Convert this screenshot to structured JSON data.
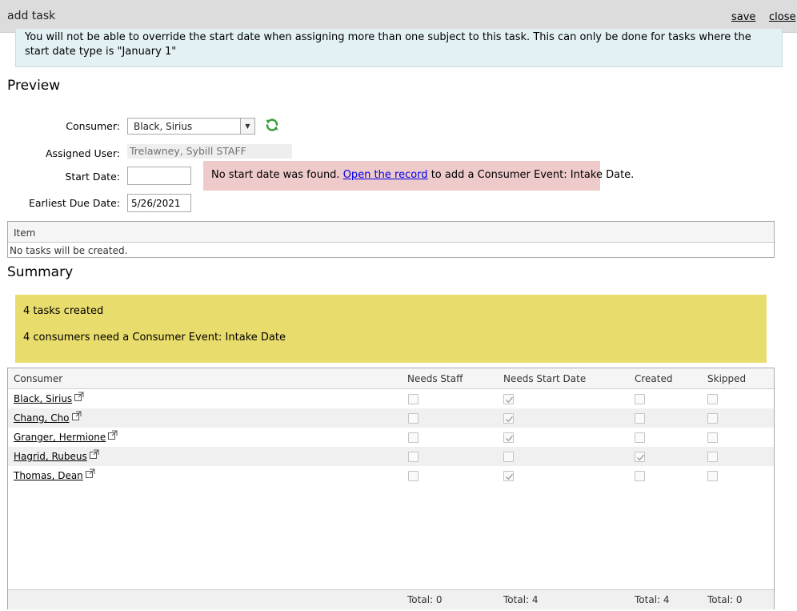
{
  "window": {
    "title": "add task",
    "save_label": "save",
    "close_label": "close"
  },
  "info_message": "You will not be able to override the start date when assigning more than one subject to this task. This can only be done for tasks where the start date type is \"January 1\"",
  "preview": {
    "title": "Preview",
    "consumer_label": "Consumer:",
    "consumer_value": "Black, Sirius",
    "assigned_user_label": "Assigned User:",
    "assigned_user_value": "Trelawney, Sybill STAFF",
    "start_date_label": "Start Date:",
    "start_date_value": "",
    "earliest_due_date_label": "Earliest Due Date:",
    "earliest_due_date_value": "5/26/2021",
    "error": {
      "prefix": "No start date was found. ",
      "link": "Open the record",
      "suffix": " to add a Consumer Event: Intake Date."
    },
    "item_table": {
      "header": "Item",
      "empty_text": "No tasks will be created."
    }
  },
  "summary": {
    "title": "Summary",
    "line1": "4 tasks created",
    "line2": "4 consumers need a Consumer Event: Intake Date"
  },
  "grid": {
    "headers": {
      "consumer": "Consumer",
      "needs_staff": "Needs Staff",
      "needs_start_date": "Needs Start Date",
      "created": "Created",
      "skipped": "Skipped"
    },
    "rows": [
      {
        "name": "Black, Sirius",
        "needs_staff": false,
        "needs_start_date": true,
        "created": false,
        "skipped": false
      },
      {
        "name": "Chang, Cho",
        "needs_staff": false,
        "needs_start_date": true,
        "created": false,
        "skipped": false
      },
      {
        "name": "Granger, Hermione",
        "needs_staff": false,
        "needs_start_date": true,
        "created": false,
        "skipped": false
      },
      {
        "name": "Hagrid, Rubeus",
        "needs_staff": false,
        "needs_start_date": false,
        "created": true,
        "skipped": false
      },
      {
        "name": "Thomas, Dean",
        "needs_staff": false,
        "needs_start_date": true,
        "created": false,
        "skipped": false
      }
    ],
    "totals": {
      "needs_staff": "Total: 0",
      "needs_start_date": "Total: 4",
      "created": "Total: 4",
      "skipped": "Total: 0"
    }
  },
  "icons": {
    "refresh": "refresh-icon",
    "external_link": "external-link-icon",
    "dropdown": "chevron-down-icon"
  },
  "colors": {
    "info_bg": "#e3f1f5",
    "error_bg": "#efcaca",
    "summary_bg": "#e8dc6c",
    "link": "#0000ee",
    "refresh_green": "#3aa03a"
  }
}
